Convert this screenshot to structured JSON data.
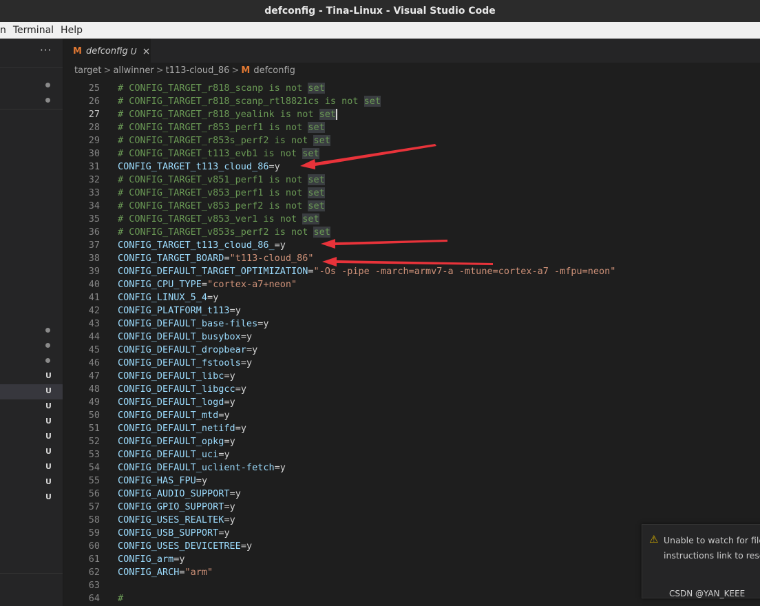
{
  "window": {
    "title": "defconfig - Tina-Linux - Visual Studio Code"
  },
  "menu": {
    "items": [
      "n",
      "Terminal",
      "Help"
    ]
  },
  "sidebar": {
    "more": "···",
    "u_mark": "U"
  },
  "tab": {
    "icon_letter": "M",
    "name": "defconfig",
    "status": "U",
    "close": "×"
  },
  "breadcrumb": {
    "parts": [
      "target",
      "allwinner",
      "t113-cloud_86"
    ],
    "file_icon": "M",
    "file": "defconfig",
    "separator": ">"
  },
  "editor": {
    "active_line": 27,
    "lines": [
      {
        "n": 25,
        "kind": "comment",
        "text": "# CONFIG_TARGET_r818_scanp is not ",
        "hl": "set"
      },
      {
        "n": 26,
        "kind": "comment",
        "text": "# CONFIG_TARGET_r818_scanp_rtl8821cs is not ",
        "hl": "set"
      },
      {
        "n": 27,
        "kind": "comment",
        "text": "# CONFIG_TARGET_r818_yealink is not ",
        "hl": "set"
      },
      {
        "n": 28,
        "kind": "comment",
        "text": "# CONFIG_TARGET_r853_perf1 is not ",
        "hl": "set"
      },
      {
        "n": 29,
        "kind": "comment",
        "text": "# CONFIG_TARGET_r853s_perf2 is not ",
        "hl": "set"
      },
      {
        "n": 30,
        "kind": "comment",
        "text": "# CONFIG_TARGET_t113_evb1 is not ",
        "hl": "set"
      },
      {
        "n": 31,
        "kind": "assign",
        "key": "CONFIG_TARGET_t113_cloud_86",
        "val": "y"
      },
      {
        "n": 32,
        "kind": "comment",
        "text": "# CONFIG_TARGET_v851_perf1 is not ",
        "hl": "set"
      },
      {
        "n": 33,
        "kind": "comment",
        "text": "# CONFIG_TARGET_v853_perf1 is not ",
        "hl": "set"
      },
      {
        "n": 34,
        "kind": "comment",
        "text": "# CONFIG_TARGET_v853_perf2 is not ",
        "hl": "set"
      },
      {
        "n": 35,
        "kind": "comment",
        "text": "# CONFIG_TARGET_v853_ver1 is not ",
        "hl": "set"
      },
      {
        "n": 36,
        "kind": "comment",
        "text": "# CONFIG_TARGET_v853s_perf2 is not ",
        "hl": "set"
      },
      {
        "n": 37,
        "kind": "assign",
        "key": "CONFIG_TARGET_t113_cloud_86_",
        "val": "y"
      },
      {
        "n": 38,
        "kind": "assign",
        "key": "CONFIG_TARGET_BOARD",
        "str": "\"t113-cloud_86\""
      },
      {
        "n": 39,
        "kind": "assign",
        "key": "CONFIG_DEFAULT_TARGET_OPTIMIZATION",
        "str": "\"-Os -pipe -march=armv7-a -mtune=cortex-a7 -mfpu=neon\""
      },
      {
        "n": 40,
        "kind": "assign",
        "key": "CONFIG_CPU_TYPE",
        "str": "\"cortex-a7+neon\""
      },
      {
        "n": 41,
        "kind": "assign",
        "key": "CONFIG_LINUX_5_4",
        "val": "y"
      },
      {
        "n": 42,
        "kind": "assign",
        "key": "CONFIG_PLATFORM_t113",
        "val": "y"
      },
      {
        "n": 43,
        "kind": "assign",
        "key": "CONFIG_DEFAULT_base-files",
        "val": "y"
      },
      {
        "n": 44,
        "kind": "assign",
        "key": "CONFIG_DEFAULT_busybox",
        "val": "y"
      },
      {
        "n": 45,
        "kind": "assign",
        "key": "CONFIG_DEFAULT_dropbear",
        "val": "y"
      },
      {
        "n": 46,
        "kind": "assign",
        "key": "CONFIG_DEFAULT_fstools",
        "val": "y"
      },
      {
        "n": 47,
        "kind": "assign",
        "key": "CONFIG_DEFAULT_libc",
        "val": "y"
      },
      {
        "n": 48,
        "kind": "assign",
        "key": "CONFIG_DEFAULT_libgcc",
        "val": "y"
      },
      {
        "n": 49,
        "kind": "assign",
        "key": "CONFIG_DEFAULT_logd",
        "val": "y"
      },
      {
        "n": 50,
        "kind": "assign",
        "key": "CONFIG_DEFAULT_mtd",
        "val": "y"
      },
      {
        "n": 51,
        "kind": "assign",
        "key": "CONFIG_DEFAULT_netifd",
        "val": "y"
      },
      {
        "n": 52,
        "kind": "assign",
        "key": "CONFIG_DEFAULT_opkg",
        "val": "y"
      },
      {
        "n": 53,
        "kind": "assign",
        "key": "CONFIG_DEFAULT_uci",
        "val": "y"
      },
      {
        "n": 54,
        "kind": "assign",
        "key": "CONFIG_DEFAULT_uclient-fetch",
        "val": "y"
      },
      {
        "n": 55,
        "kind": "assign",
        "key": "CONFIG_HAS_FPU",
        "val": "y"
      },
      {
        "n": 56,
        "kind": "assign",
        "key": "CONFIG_AUDIO_SUPPORT",
        "val": "y"
      },
      {
        "n": 57,
        "kind": "assign",
        "key": "CONFIG_GPIO_SUPPORT",
        "val": "y"
      },
      {
        "n": 58,
        "kind": "assign",
        "key": "CONFIG_USES_REALTEK",
        "val": "y"
      },
      {
        "n": 59,
        "kind": "assign",
        "key": "CONFIG_USB_SUPPORT",
        "val": "y"
      },
      {
        "n": 60,
        "kind": "assign",
        "key": "CONFIG_USES_DEVICETREE",
        "val": "y"
      },
      {
        "n": 61,
        "kind": "assign",
        "key": "CONFIG_arm",
        "val": "y"
      },
      {
        "n": 62,
        "kind": "assign",
        "key": "CONFIG_ARCH",
        "str": "\"arm\""
      },
      {
        "n": 63,
        "kind": "blank"
      },
      {
        "n": 64,
        "kind": "comment",
        "text": "#"
      }
    ]
  },
  "notification": {
    "line1": "Unable to watch for file",
    "line2": "instructions link to resol"
  },
  "watermark": "CSDN @YAN_KEEE",
  "colors": {
    "annotation_arrow": "#e8333a",
    "comment": "#6a9955",
    "key": "#9cdcfe",
    "string": "#ce9178"
  }
}
